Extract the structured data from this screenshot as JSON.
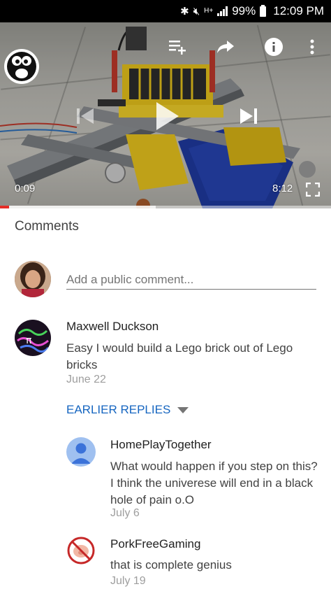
{
  "status_bar": {
    "battery": "99%",
    "time": "12:09 PM"
  },
  "video": {
    "elapsed": "0:09",
    "duration": "8:12",
    "progress_fraction": 0.027,
    "buffered_fraction": 0.47,
    "icons": [
      "add-to-playlist-icon",
      "share-icon",
      "info-icon",
      "more-vert-icon",
      "previous-icon",
      "play-icon",
      "next-icon",
      "fullscreen-icon"
    ]
  },
  "comments": {
    "title": "Comments",
    "add_placeholder": "Add a public comment...",
    "items": [
      {
        "author": "Maxwell Duckson",
        "text": "Easy I would build a Lego brick out of Lego bricks",
        "date": "June 22"
      }
    ],
    "earlier_replies": "EARLIER REPLIES",
    "replies": [
      {
        "author": "HomePlayTogether",
        "text": "What would happen if you step on this? I think the univerese will end in a black hole of pain o.O",
        "date": "July 6"
      },
      {
        "author": "PorkFreeGaming",
        "text": "that is complete genius",
        "date": "July 19"
      }
    ]
  },
  "colors": {
    "accent_red": "#e52d27",
    "link_blue": "#1565c0"
  }
}
